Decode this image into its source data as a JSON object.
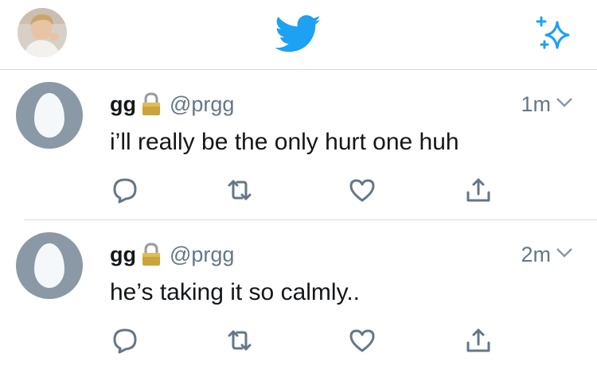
{
  "header": {
    "avatar_icon": "profile-photo",
    "logo_icon": "twitter-bird-icon",
    "sparkle_icon": "sparkle-icon",
    "accent_color": "#1da1f2"
  },
  "tweets": [
    {
      "name": "gg",
      "handle": "@prgg",
      "time": "1m",
      "text": "i’ll really be the only hurt one huh",
      "protected": true
    },
    {
      "name": "gg",
      "handle": "@prgg",
      "time": "2m",
      "text": "he’s taking it so calmly..",
      "protected": true
    }
  ],
  "action_icons": [
    "reply-icon",
    "retweet-icon",
    "like-icon",
    "share-icon"
  ],
  "colors": {
    "secondary_text": "#657786",
    "icon_gray": "#657786",
    "divider": "#d9d9d9",
    "egg_background": "#8b99a6"
  }
}
